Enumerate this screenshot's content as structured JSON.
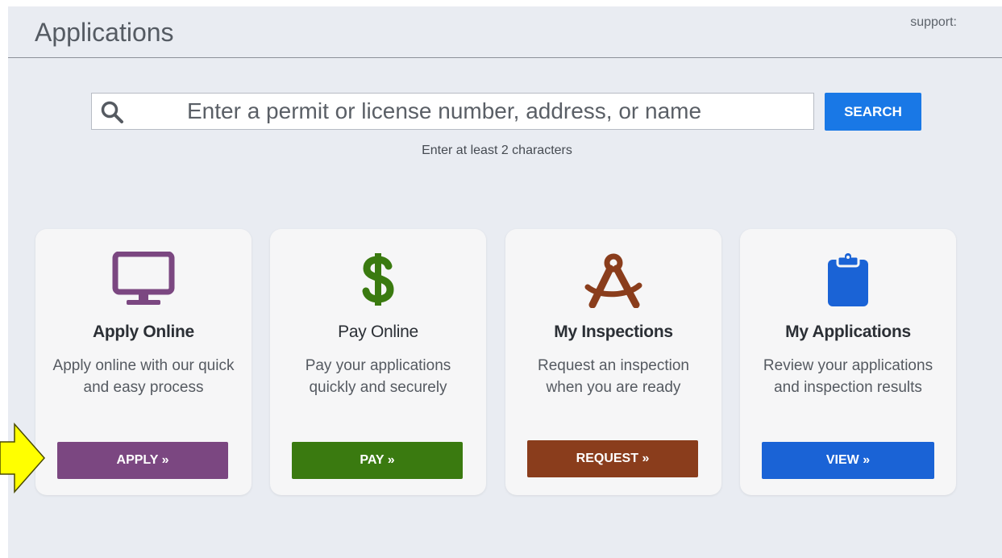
{
  "header": {
    "title": "Applications",
    "support_label": "support:"
  },
  "search": {
    "placeholder": "Enter a permit or license number, address, or name",
    "value": "",
    "button_label": "SEARCH",
    "hint": "Enter at least 2 characters"
  },
  "cards": [
    {
      "title": "Apply Online",
      "description": "Apply online with our quick and easy process",
      "button_label": "APPLY »",
      "icon": "monitor-icon",
      "color": "#7b4781"
    },
    {
      "title": "Pay Online",
      "description": "Pay your applications quickly and securely",
      "button_label": "PAY »",
      "icon": "dollar-icon",
      "color": "#3a7a10"
    },
    {
      "title": "My Inspections",
      "description": "Request an inspection when you are ready",
      "button_label": "REQUEST »",
      "icon": "compass-icon",
      "color": "#8a3d1c"
    },
    {
      "title": "My Applications",
      "description": "Review your applications and inspection results",
      "button_label": "VIEW »",
      "icon": "clipboard-icon",
      "color": "#1a63d6"
    }
  ],
  "annotation": {
    "icon": "yellow-arrow-icon",
    "color": "#ffff00"
  },
  "colors": {
    "background": "#e9ecf2",
    "search_button": "#1978e6"
  }
}
